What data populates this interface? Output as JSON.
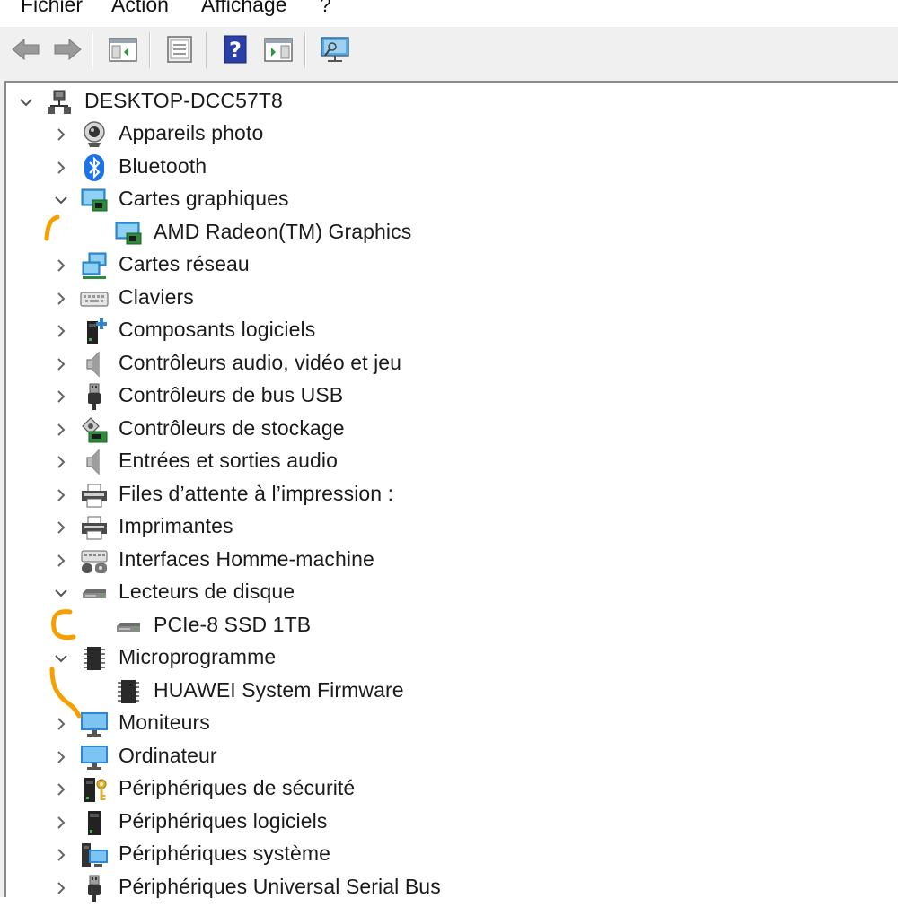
{
  "menu": {
    "items": [
      "Fichier",
      "Action",
      "Affichage",
      "?"
    ]
  },
  "toolbar": {
    "buttons": [
      "back-icon",
      "forward-icon",
      "show-hide-console-tree-icon",
      "properties-icon",
      "help-icon",
      "action-pane-icon",
      "scan-hardware-icon"
    ]
  },
  "tree": {
    "root": {
      "label": "DESKTOP-DCC57T8",
      "expanded": true,
      "icon": "computer-network-icon"
    },
    "nodes": [
      {
        "label": "Appareils photo",
        "expanded": false,
        "icon": "webcam-icon"
      },
      {
        "label": "Bluetooth",
        "expanded": false,
        "icon": "bluetooth-icon"
      },
      {
        "label": "Cartes graphiques",
        "expanded": true,
        "icon": "display-adapter-icon"
      },
      {
        "label": "AMD Radeon(TM) Graphics",
        "child": true,
        "icon": "display-adapter-icon"
      },
      {
        "label": "Cartes réseau",
        "expanded": false,
        "icon": "network-adapter-icon"
      },
      {
        "label": "Claviers",
        "expanded": false,
        "icon": "keyboard-icon"
      },
      {
        "label": "Composants logiciels",
        "expanded": false,
        "icon": "software-component-icon"
      },
      {
        "label": "Contrôleurs audio, vidéo et jeu",
        "expanded": false,
        "icon": "speaker-icon"
      },
      {
        "label": "Contrôleurs de bus USB",
        "expanded": false,
        "icon": "usb-icon"
      },
      {
        "label": "Contrôleurs de stockage",
        "expanded": false,
        "icon": "storage-controller-icon"
      },
      {
        "label": "Entrées et sorties audio",
        "expanded": false,
        "icon": "speaker-icon"
      },
      {
        "label": "Files d’attente à l’impression :",
        "expanded": false,
        "icon": "printer-icon"
      },
      {
        "label": "Imprimantes",
        "expanded": false,
        "icon": "printer-icon"
      },
      {
        "label": "Interfaces Homme-machine",
        "expanded": false,
        "icon": "hid-icon"
      },
      {
        "label": "Lecteurs de disque",
        "expanded": true,
        "icon": "disk-drive-icon"
      },
      {
        "label": "PCIe-8 SSD 1TB",
        "child": true,
        "icon": "disk-drive-icon"
      },
      {
        "label": "Microprogramme",
        "expanded": true,
        "icon": "firmware-chip-icon"
      },
      {
        "label": "HUAWEI System Firmware",
        "child": true,
        "icon": "firmware-chip-icon"
      },
      {
        "label": "Moniteurs",
        "expanded": false,
        "icon": "monitor-icon"
      },
      {
        "label": "Ordinateur",
        "expanded": false,
        "icon": "monitor-icon"
      },
      {
        "label": "Périphériques de sécurité",
        "expanded": false,
        "icon": "security-device-icon"
      },
      {
        "label": "Périphériques logiciels",
        "expanded": false,
        "icon": "software-device-icon"
      },
      {
        "label": "Périphériques système",
        "expanded": false,
        "icon": "system-device-icon"
      },
      {
        "label": "Périphériques Universal Serial Bus",
        "expanded": false,
        "icon": "usb-icon"
      }
    ]
  },
  "colors": {
    "annotation": "#f5a000",
    "toolbar_bg": "#f0f0f0",
    "text": "#1b1b1b",
    "chevron": "#666666"
  }
}
